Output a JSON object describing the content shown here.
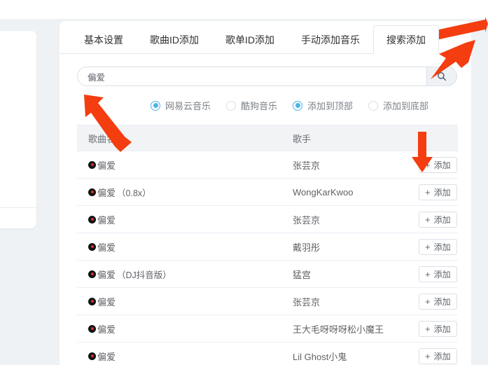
{
  "tabs": [
    {
      "label": "基本设置",
      "active": false
    },
    {
      "label": "歌曲ID添加",
      "active": false
    },
    {
      "label": "歌单ID添加",
      "active": false
    },
    {
      "label": "手动添加音乐",
      "active": false
    },
    {
      "label": "搜索添加",
      "active": true
    }
  ],
  "search": {
    "value": "偏爱",
    "placeholder": "",
    "button_icon": "search-icon"
  },
  "radios": [
    {
      "label": "网易云音乐",
      "checked": true
    },
    {
      "label": "酷狗音乐",
      "checked": false
    },
    {
      "label": "添加到顶部",
      "checked": true
    },
    {
      "label": "添加到底部",
      "checked": false
    }
  ],
  "table": {
    "columns": [
      "歌曲名称",
      "歌手",
      ""
    ],
    "action_label": "添加",
    "action_icon": "plus-icon",
    "rows": [
      {
        "song": "偏爱",
        "variant": "",
        "artist": "张芸京"
      },
      {
        "song": "偏爱",
        "variant": "（0.8x）",
        "artist": "WongKarKwoo"
      },
      {
        "song": "偏爱",
        "variant": "",
        "artist": "张芸京"
      },
      {
        "song": "偏爱",
        "variant": "",
        "artist": "戴羽彤"
      },
      {
        "song": "偏爱",
        "variant": "（DJ抖音版）",
        "artist": "猛宫"
      },
      {
        "song": "偏爱",
        "variant": "",
        "artist": "张芸京"
      },
      {
        "song": "偏爱",
        "variant": "",
        "artist": "王大毛呀呀呀松小魔王"
      },
      {
        "song": "偏爱",
        "variant": "",
        "artist": "Lil Ghost小鬼"
      }
    ]
  },
  "colors": {
    "accent": "#4eb3e8",
    "annotation": "#f43d10",
    "page_background": "#eef2f4",
    "panel_background": "#ffffff",
    "table_header": "#f2f3f5"
  }
}
